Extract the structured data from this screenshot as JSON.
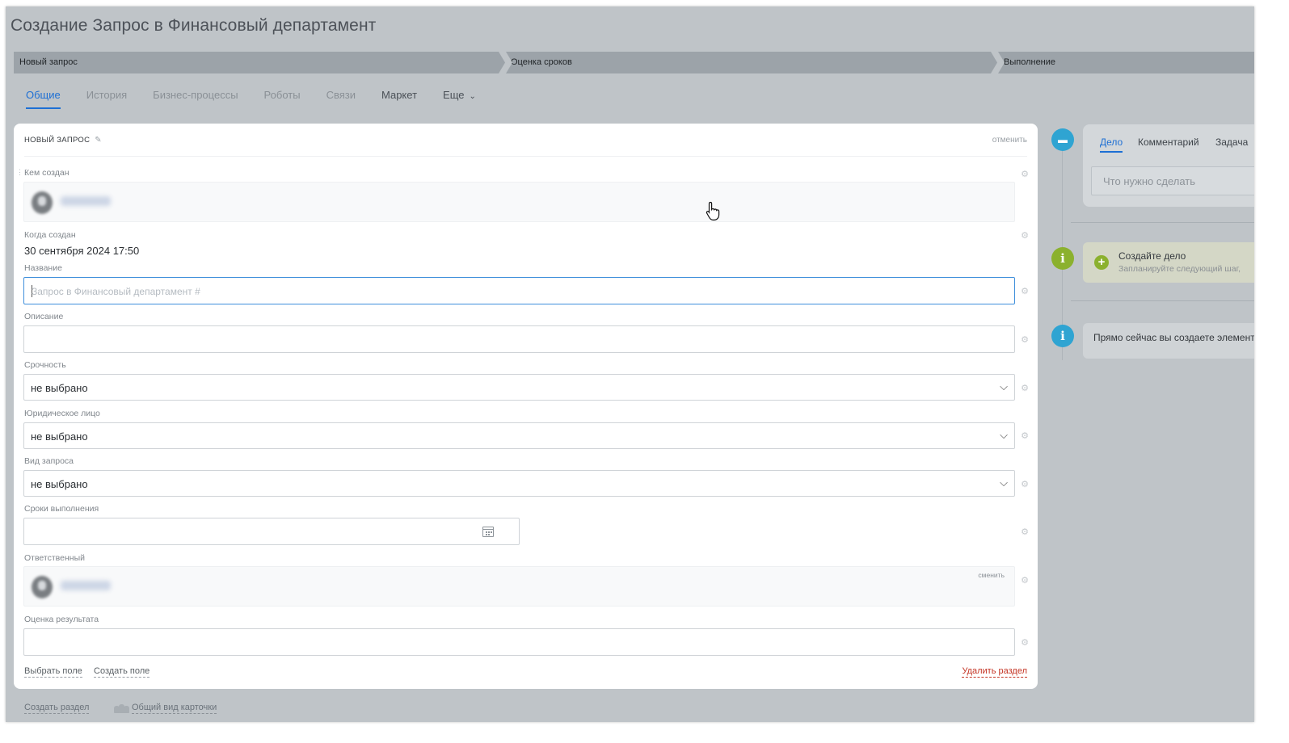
{
  "page": {
    "title": "Создание Запрос в Финансовый департамент"
  },
  "stages": [
    "Новый запрос",
    "Оценка сроков",
    "Выполнение"
  ],
  "tabs": [
    {
      "label": "Общие",
      "active": true
    },
    {
      "label": "История"
    },
    {
      "label": "Бизнес-процессы"
    },
    {
      "label": "Роботы"
    },
    {
      "label": "Связи"
    },
    {
      "label": "Маркет"
    },
    {
      "label": "Еще"
    }
  ],
  "card": {
    "title": "НОВЫЙ ЗАПРОС",
    "cancel": "отменить",
    "fields": {
      "created_by": {
        "label": "Кем создан"
      },
      "created_when": {
        "label": "Когда создан",
        "value": "30 сентября 2024 17:50"
      },
      "name": {
        "label": "Название",
        "placeholder": "Запрос в Финансовый департамент #"
      },
      "description": {
        "label": "Описание"
      },
      "urgency": {
        "label": "Срочность",
        "value": "не выбрано"
      },
      "legal_entity": {
        "label": "Юридическое лицо",
        "value": "не выбрано"
      },
      "request_type": {
        "label": "Вид запроса",
        "value": "не выбрано"
      },
      "deadline": {
        "label": "Сроки выполнения"
      },
      "responsible": {
        "label": "Ответственный",
        "change": "сменить"
      },
      "result_rating": {
        "label": "Оценка результата"
      }
    },
    "footer": {
      "select_field": "Выбрать поле",
      "create_field": "Создать поле",
      "delete_section": "Удалить раздел"
    }
  },
  "bottom": {
    "create_section": "Создать раздел",
    "card_view": "Общий вид карточки"
  },
  "activity": {
    "tabs": [
      "Дело",
      "Комментарий",
      "Задача"
    ],
    "input_placeholder": "Что нужно сделать",
    "todo_title": "Создайте дело",
    "todo_sub": "Запланируйте следующий шаг,",
    "info_text": "Прямо сейчас вы создаете элемент"
  },
  "colors": {
    "accent": "#1d6fd4",
    "danger": "#c43424",
    "green": "#8bb12e",
    "teal": "#2fa4d2"
  }
}
